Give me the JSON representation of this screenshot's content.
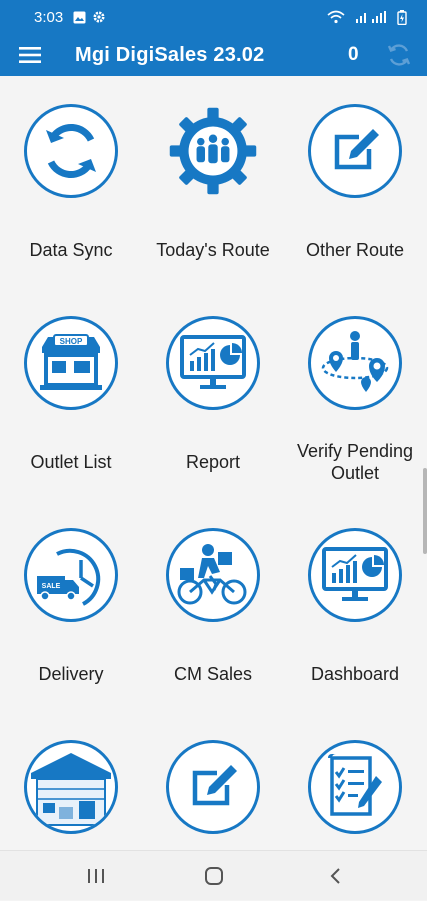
{
  "status_bar": {
    "time": "3:03",
    "icons": [
      "image-icon",
      "gear-icon",
      "wifi-icon",
      "signal-icon",
      "battery-icon"
    ]
  },
  "app_bar": {
    "title": "Mgi DigiSales 23.02",
    "counter": "0",
    "menu_icon": "hamburger-menu-icon",
    "sync_icon": "refresh-icon"
  },
  "menu": {
    "items": [
      {
        "label": "Data Sync",
        "icon": "sync-icon"
      },
      {
        "label": "Today's Route",
        "icon": "team-gear-icon"
      },
      {
        "label": "Other Route",
        "icon": "edit-square-icon"
      },
      {
        "label": "Outlet List",
        "icon": "shop-icon"
      },
      {
        "label": "Report",
        "icon": "monitor-chart-icon"
      },
      {
        "label": "Verify Pending Outlet",
        "icon": "map-pin-route-icon"
      },
      {
        "label": "Delivery",
        "icon": "delivery-truck-clock-icon"
      },
      {
        "label": "CM Sales",
        "icon": "courier-bicycle-icon"
      },
      {
        "label": "Dashboard",
        "icon": "monitor-chart-icon"
      },
      {
        "label": "",
        "icon": "warehouse-icon"
      },
      {
        "label": "",
        "icon": "edit-square-icon"
      },
      {
        "label": "",
        "icon": "checklist-icon"
      }
    ]
  },
  "colors": {
    "primary": "#1778c4",
    "background": "#f4f4f4",
    "text": "#222222"
  },
  "nav_bar": {
    "icons": [
      "recent-apps-icon",
      "home-icon",
      "back-icon"
    ]
  }
}
